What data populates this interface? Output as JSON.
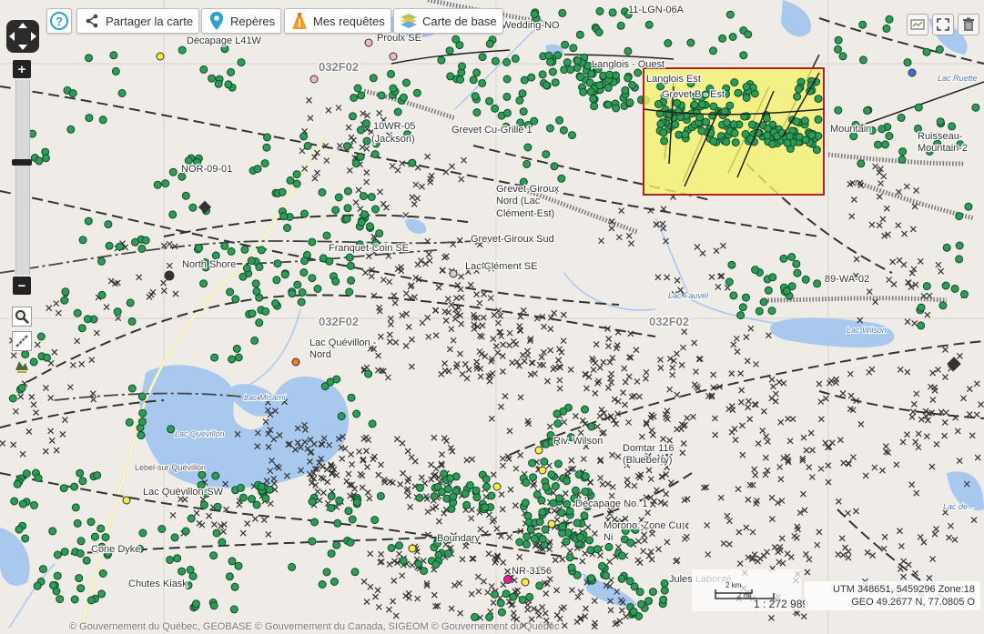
{
  "toolbar": {
    "help_label": "?",
    "share_label": "Partager la carte",
    "markers_label": "Repères",
    "queries_label": "Mes requêtes",
    "basemap_label": "Carte de base"
  },
  "zoom": {
    "in_label": "+",
    "out_label": "−"
  },
  "map": {
    "sheet_labels": [
      "032F02",
      "032F02",
      "032F02"
    ],
    "places": [
      "Riv. Wedding-NO",
      "11-LGN-06A",
      "Décapage L41W",
      "Proulx SE",
      "Langlois - Ouest",
      "Langlois Est",
      "Grevet B - Est",
      "Mountain",
      "Ruisseau-",
      "Mountain-2",
      "10WR-05",
      "(Jackson)",
      "Grevet Cu-Grille 1",
      "NOR-09-01",
      "Grevet-Giroux",
      "Nord (Lac",
      "Clément-Est)",
      "Franquet-Coin SE",
      "Grevet-Giroux Sud",
      "North Shore",
      "Lac Clément SE",
      "89-WA-02",
      "Lac Quévillon -",
      "Nord",
      "Riv. Wilson",
      "Domtar 116",
      "(Blueberry)",
      "Lac Quévillon-SW",
      "Décapage No. 1",
      "Morono: Zone Cu-",
      "Ni",
      "Cone Dyke",
      "Boundary",
      "Chutes Kiask",
      "NR-3156",
      "Jules Labonté",
      "Lebel-sur-Quévillon"
    ],
    "water_labels": [
      "Lac Misami",
      "Lac Quévillon",
      "Lac Fauvel",
      "Lac Wilson",
      "Lac Ruette",
      "Lac de..."
    ]
  },
  "scale": {
    "km_label": "2 km",
    "mi_label": "2 mi",
    "ratio": "1 : 272 989"
  },
  "coords": {
    "utm": "UTM 348651, 5459296 Zone:18",
    "geo": "GEO 49.2677 N, 77.0805 O"
  },
  "footer": "© Gouvernement du Québec, GEOBASE © Gouvernement du Canada, SIGEOM © Gouvernement du Québec",
  "colors": {
    "land": "#efebe7",
    "water": "#a8c8ee",
    "occurrence": "#2e9b57",
    "selection": "#f4f26a",
    "selection_border": "#b22222",
    "help": "#2aa3c9"
  },
  "icons": [
    "help-icon",
    "share-icon",
    "marker-icon",
    "queries-icon",
    "basemap-icon",
    "zoom-box-icon",
    "measure-icon",
    "layers-icon",
    "fullscreen-icon",
    "trash-icon",
    "pan-icon"
  ]
}
